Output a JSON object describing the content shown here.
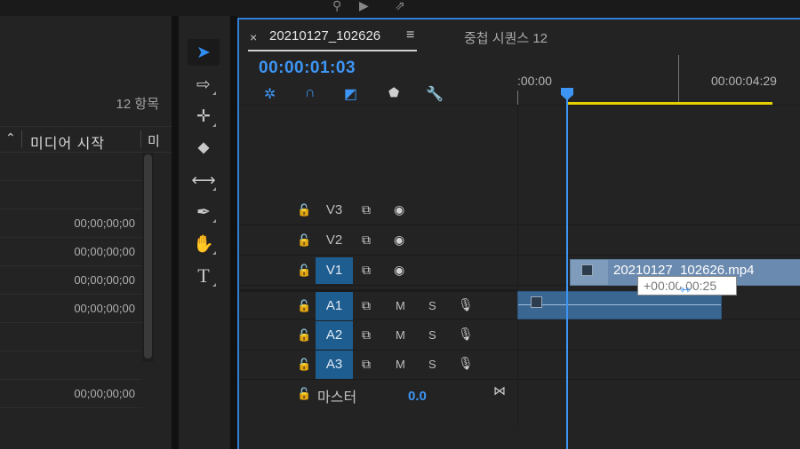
{
  "project_panel": {
    "item_count": "12 항목",
    "column_media_start": "미디어 시작",
    "column_next": "미",
    "timecodes": [
      "",
      "",
      "00;00;00;00",
      "00;00;00;00",
      "00;00;00;00",
      "00;00;00;00",
      "",
      "",
      "00;00;00;00"
    ]
  },
  "tools": [
    {
      "name": "selection-tool",
      "glyph": "➤",
      "active": true
    },
    {
      "name": "track-select-forward-tool",
      "glyph": "⇨"
    },
    {
      "name": "ripple-edit-tool",
      "glyph": "✛"
    },
    {
      "name": "razor-tool",
      "glyph": "⬥"
    },
    {
      "name": "slip-tool",
      "glyph": "⟷"
    },
    {
      "name": "pen-tool",
      "glyph": "✒"
    },
    {
      "name": "hand-tool",
      "glyph": "✋"
    },
    {
      "name": "type-tool",
      "glyph": "T"
    }
  ],
  "timeline": {
    "tab_close": "×",
    "sequence_tab": "20210127_102626",
    "tab_menu": "≡",
    "nested_tab": "중첩 시퀀스 12",
    "timecode": "00:00:01:03",
    "ruler_start": ":00:00",
    "ruler_end": "00:00:04:29",
    "tracks": [
      {
        "id": "V3",
        "kind": "video",
        "selected": false
      },
      {
        "id": "V2",
        "kind": "video",
        "selected": false
      },
      {
        "id": "V1",
        "kind": "video",
        "selected": true
      },
      {
        "id": "A1",
        "kind": "audio",
        "selected": true
      },
      {
        "id": "A2",
        "kind": "audio",
        "selected": true
      },
      {
        "id": "A3",
        "kind": "audio",
        "selected": true
      }
    ],
    "mute_label": "M",
    "solo_label": "S",
    "master_label": "마스터",
    "master_value": "0.0",
    "clip_name": "20210127_102626.mp4",
    "tooltip": "+00:00:00:25"
  },
  "colors": {
    "accent": "#3d95f5",
    "track_selected": "#1e5d8f",
    "workarea": "#e8d000"
  }
}
